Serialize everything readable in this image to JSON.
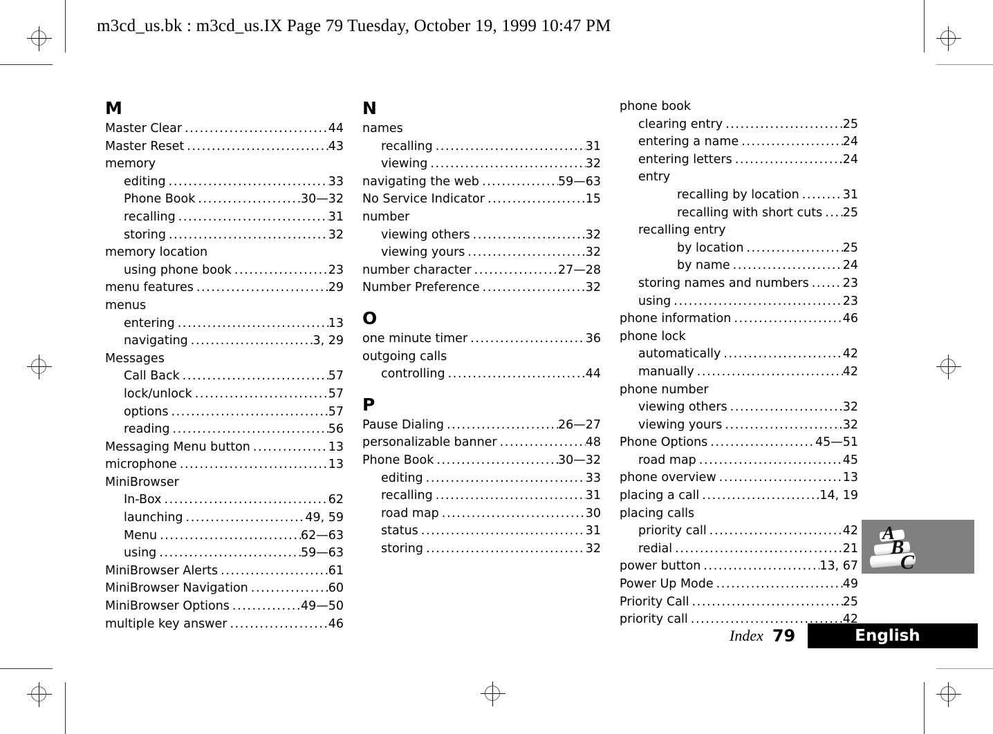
{
  "header": {
    "text": "m3cd_us.bk : m3cd_us.IX  Page 79  Tuesday, October 19, 1999  10:47 PM"
  },
  "footer": {
    "index_label": "Index",
    "page_number": "79",
    "language": "English",
    "bar_color": "#000000"
  },
  "logo": {
    "letters": [
      "A",
      "B",
      "C"
    ],
    "box_color": "#808080"
  },
  "columns": [
    {
      "id": "column-1",
      "blocks": [
        {
          "heading": "M",
          "spaced": false,
          "entries": [
            {
              "level": 0,
              "label": "Master Clear",
              "page": "44"
            },
            {
              "level": 0,
              "label": "Master Reset",
              "page": "43"
            },
            {
              "level": 0,
              "label": "memory",
              "page": ""
            },
            {
              "level": 1,
              "label": "editing",
              "page": "33"
            },
            {
              "level": 1,
              "label": "Phone Book",
              "page": "30—32"
            },
            {
              "level": 1,
              "label": "recalling",
              "page": "31"
            },
            {
              "level": 1,
              "label": "storing",
              "page": "32"
            },
            {
              "level": 0,
              "label": "memory location",
              "page": ""
            },
            {
              "level": 1,
              "label": "using phone book",
              "page": "23"
            },
            {
              "level": 0,
              "label": "menu features",
              "page": "29"
            },
            {
              "level": 0,
              "label": "menus",
              "page": ""
            },
            {
              "level": 1,
              "label": "entering",
              "page": "13"
            },
            {
              "level": 1,
              "label": "navigating",
              "page": "3, 29"
            },
            {
              "level": 0,
              "label": "Messages",
              "page": ""
            },
            {
              "level": 1,
              "label": "Call Back",
              "page": "57"
            },
            {
              "level": 1,
              "label": "lock/unlock",
              "page": "57"
            },
            {
              "level": 1,
              "label": "options",
              "page": "57"
            },
            {
              "level": 1,
              "label": "reading",
              "page": "56"
            },
            {
              "level": 0,
              "label": "Messaging Menu button",
              "page": "13"
            },
            {
              "level": 0,
              "label": "microphone",
              "page": "13"
            },
            {
              "level": 0,
              "label": "MiniBrowser",
              "page": ""
            },
            {
              "level": 1,
              "label": "In-Box",
              "page": "62"
            },
            {
              "level": 1,
              "label": "launching",
              "page": "49, 59"
            },
            {
              "level": 1,
              "label": "Menu",
              "page": "62—63"
            },
            {
              "level": 1,
              "label": "using",
              "page": "59—63"
            },
            {
              "level": 0,
              "label": "MiniBrowser Alerts",
              "page": "61"
            },
            {
              "level": 0,
              "label": "MiniBrowser Navigation",
              "page": "60"
            },
            {
              "level": 0,
              "label": "MiniBrowser Options",
              "page": "49—50"
            },
            {
              "level": 0,
              "label": "multiple key answer",
              "page": "46"
            }
          ]
        }
      ]
    },
    {
      "id": "column-2",
      "blocks": [
        {
          "heading": "N",
          "spaced": false,
          "entries": [
            {
              "level": 0,
              "label": "names",
              "page": ""
            },
            {
              "level": 1,
              "label": "recalling",
              "page": "31"
            },
            {
              "level": 1,
              "label": "viewing",
              "page": "32"
            },
            {
              "level": 0,
              "label": "navigating the web",
              "page": "59—63"
            },
            {
              "level": 0,
              "label": "No Service Indicator",
              "page": "15"
            },
            {
              "level": 0,
              "label": "number",
              "page": ""
            },
            {
              "level": 1,
              "label": "viewing others",
              "page": "32"
            },
            {
              "level": 1,
              "label": "viewing yours",
              "page": "32"
            },
            {
              "level": 0,
              "label": "number character",
              "page": "27—28"
            },
            {
              "level": 0,
              "label": "Number Preference",
              "page": "32"
            }
          ]
        },
        {
          "heading": "O",
          "spaced": true,
          "entries": [
            {
              "level": 0,
              "label": "one minute timer",
              "page": "36"
            },
            {
              "level": 0,
              "label": "outgoing calls",
              "page": ""
            },
            {
              "level": 1,
              "label": "controlling",
              "page": "44"
            }
          ]
        },
        {
          "heading": "P",
          "spaced": true,
          "entries": [
            {
              "level": 0,
              "label": "Pause Dialing",
              "page": "26—27"
            },
            {
              "level": 0,
              "label": "personalizable banner",
              "page": "48"
            },
            {
              "level": 0,
              "label": "Phone Book",
              "page": "30—32"
            },
            {
              "level": 1,
              "label": "editing",
              "page": "33"
            },
            {
              "level": 1,
              "label": "recalling",
              "page": "31"
            },
            {
              "level": 1,
              "label": "road map",
              "page": "30"
            },
            {
              "level": 1,
              "label": "status",
              "page": "31"
            },
            {
              "level": 1,
              "label": "storing",
              "page": "32"
            }
          ]
        }
      ]
    },
    {
      "id": "column-3",
      "blocks": [
        {
          "heading": "",
          "spaced": false,
          "entries": [
            {
              "level": 0,
              "label": "phone book",
              "page": ""
            },
            {
              "level": 1,
              "label": "clearing entry",
              "page": "25"
            },
            {
              "level": 1,
              "label": "entering a name",
              "page": "24"
            },
            {
              "level": 1,
              "label": "entering letters",
              "page": "24"
            },
            {
              "level": 1,
              "label": "entry",
              "page": ""
            },
            {
              "level": 2,
              "label": "recalling by location",
              "page": "31"
            },
            {
              "level": 2,
              "label": "recalling with short cuts",
              "page": "25"
            },
            {
              "level": 1,
              "label": "recalling entry",
              "page": ""
            },
            {
              "level": 2,
              "label": "by location",
              "page": "25"
            },
            {
              "level": 2,
              "label": "by name",
              "page": "24"
            },
            {
              "level": 1,
              "label": "storing names and numbers",
              "page": "23"
            },
            {
              "level": 1,
              "label": "using",
              "page": "23"
            },
            {
              "level": 0,
              "label": "phone information",
              "page": "46"
            },
            {
              "level": 0,
              "label": "phone lock",
              "page": ""
            },
            {
              "level": 1,
              "label": "automatically",
              "page": "42"
            },
            {
              "level": 1,
              "label": "manually",
              "page": "42"
            },
            {
              "level": 0,
              "label": "phone number",
              "page": ""
            },
            {
              "level": 1,
              "label": "viewing others",
              "page": "32"
            },
            {
              "level": 1,
              "label": "viewing yours",
              "page": "32"
            },
            {
              "level": 0,
              "label": "Phone Options",
              "page": "45—51"
            },
            {
              "level": 1,
              "label": "road map",
              "page": "45"
            },
            {
              "level": 0,
              "label": "phone overview",
              "page": "13"
            },
            {
              "level": 0,
              "label": "placing a call",
              "page": "14, 19"
            },
            {
              "level": 0,
              "label": "placing calls",
              "page": ""
            },
            {
              "level": 1,
              "label": "priority call",
              "page": "42"
            },
            {
              "level": 1,
              "label": "redial",
              "page": "21"
            },
            {
              "level": 0,
              "label": "power button",
              "page": "13, 67"
            },
            {
              "level": 0,
              "label": "Power Up Mode",
              "page": "49"
            },
            {
              "level": 0,
              "label": "Priority Call",
              "page": "25"
            },
            {
              "level": 0,
              "label": "priority call",
              "page": "42"
            }
          ]
        }
      ]
    }
  ]
}
